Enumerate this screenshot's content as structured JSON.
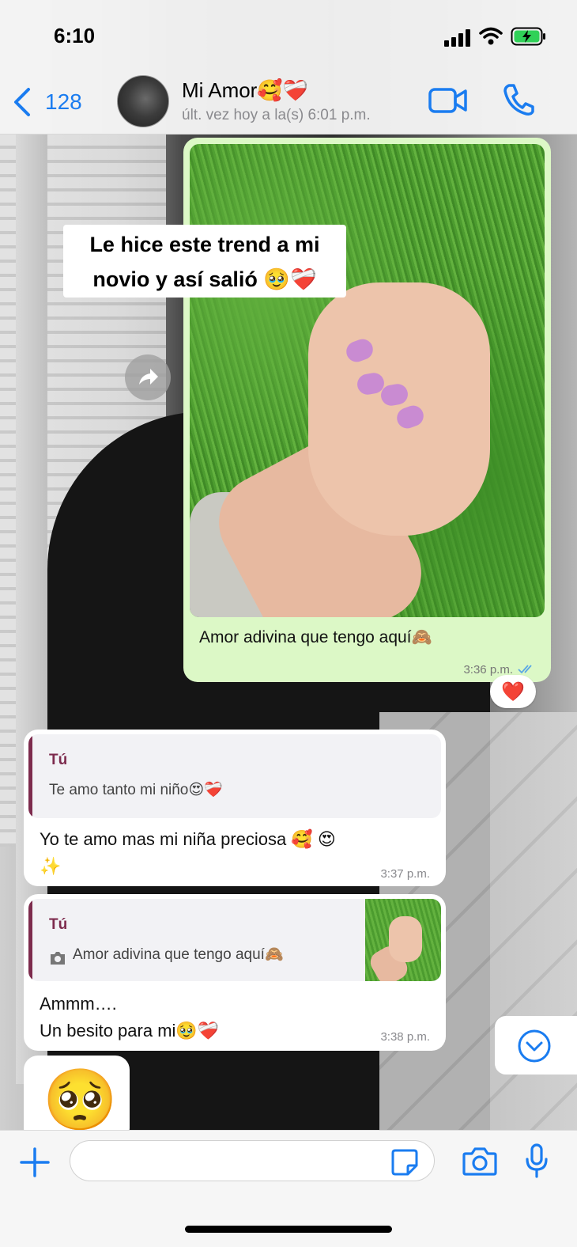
{
  "status_bar": {
    "time": "6:10"
  },
  "header": {
    "back_count": "128",
    "contact_name": "Mi Amor🥰❤️‍🩹",
    "last_seen": "últ. vez hoy a la(s) 6:01 p.m."
  },
  "overlay": {
    "line1": "Le hice este trend a mi",
    "line2": "novio y así salió 🥹❤️‍🩹"
  },
  "messages": {
    "outgoing_image": {
      "caption": "Amor adivina que tengo aquí🙈",
      "time": "3:36 p.m.",
      "reaction": "❤️"
    },
    "reply1": {
      "quoted_author": "Tú",
      "quoted_text": "Te amo tanto mi niño😍❤️‍🩹",
      "text_line1": "Yo te amo mas mi niña preciosa 🥰 😍",
      "text_line2": "✨",
      "time": "3:37 p.m."
    },
    "reply2": {
      "quoted_author": "Tú",
      "quoted_text": "Amor adivina que tengo aquí🙈",
      "text_line1": "Ammm….",
      "text_line2": "Un besito para mi🥹❤️‍🩹",
      "time": "3:38 p.m."
    },
    "emoji_message": "🥺"
  },
  "composer": {
    "input_value": ""
  },
  "colors": {
    "accent": "#1a7cf0",
    "outgoing_bubble": "#dcf8c6",
    "quote_bar": "#7d2b4d"
  },
  "icons": [
    "back-chevron-icon",
    "video-call-icon",
    "phone-icon",
    "forward-icon",
    "double-check-icon",
    "camera-icon",
    "chevron-down-icon",
    "plus-icon",
    "sticker-icon",
    "microphone-icon"
  ]
}
